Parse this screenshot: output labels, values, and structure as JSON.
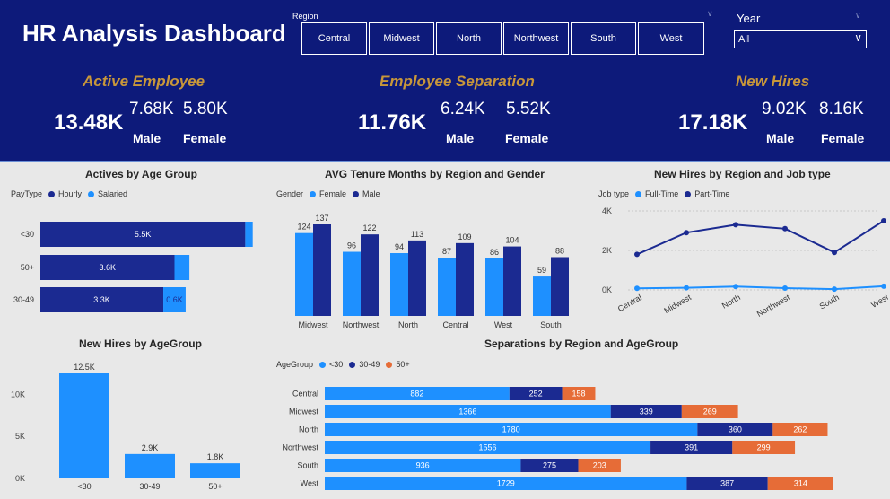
{
  "header": {
    "title": "HR Analysis Dashboard",
    "region_label": "Region",
    "regions": [
      "Central",
      "Midwest",
      "North",
      "Northwest",
      "South",
      "West"
    ],
    "year_label": "Year",
    "year_value": "All"
  },
  "kpis": {
    "active": {
      "title": "Active Employee",
      "total": "13.48K",
      "male": "7.68K",
      "female": "5.80K",
      "male_label": "Male",
      "female_label": "Female"
    },
    "separation": {
      "title": "Employee Separation",
      "total": "11.76K",
      "male": "6.24K",
      "female": "5.52K",
      "male_label": "Male",
      "female_label": "Female"
    },
    "newhires": {
      "title": "New Hires",
      "total": "17.18K",
      "male": "9.02K",
      "female": "8.16K",
      "male_label": "Male",
      "female_label": "Female"
    }
  },
  "colors": {
    "navy": "#1b2a91",
    "blue": "#1e90ff",
    "orange": "#e66c37",
    "header_bg": "#0d1a7a",
    "kpi_gold": "#c8973a"
  },
  "chart_data": [
    {
      "id": "actives-age",
      "type": "bar",
      "orientation": "horizontal",
      "stacked": true,
      "title": "Actives by Age Group",
      "legend_title": "PayType",
      "categories": [
        "<30",
        "50+",
        "30-49"
      ],
      "series": [
        {
          "name": "Hourly",
          "values": [
            5.5,
            3.6,
            3.3
          ],
          "labels": [
            "5.5K",
            "3.6K",
            "3.3K"
          ],
          "color": "#1b2a91"
        },
        {
          "name": "Salaried",
          "values": [
            0.2,
            0.4,
            0.6
          ],
          "labels": [
            "",
            "",
            "0.6K"
          ],
          "color": "#1e90ff"
        }
      ],
      "xlim": [
        0,
        5.9
      ]
    },
    {
      "id": "tenure",
      "type": "bar",
      "orientation": "vertical",
      "title": "AVG Tenure Months by Region and Gender",
      "legend_title": "Gender",
      "categories": [
        "Midwest",
        "Northwest",
        "North",
        "Central",
        "West",
        "South"
      ],
      "series": [
        {
          "name": "Female",
          "values": [
            124,
            96,
            94,
            87,
            86,
            59
          ],
          "color": "#1e90ff"
        },
        {
          "name": "Male",
          "values": [
            137,
            122,
            113,
            109,
            104,
            88
          ],
          "color": "#1b2a91"
        }
      ],
      "ylim": [
        0,
        137
      ]
    },
    {
      "id": "newhires-region",
      "type": "line",
      "title": "New Hires by Region and Job type",
      "legend_title": "Job type",
      "categories": [
        "Central",
        "Midwest",
        "North",
        "Northwest",
        "South",
        "West"
      ],
      "yticks": [
        "0K",
        "2K",
        "4K"
      ],
      "series": [
        {
          "name": "Full-Time",
          "values": [
            80,
            110,
            170,
            90,
            40,
            190
          ],
          "color": "#1e90ff"
        },
        {
          "name": "Part-Time",
          "values": [
            1800,
            2900,
            3300,
            3100,
            1900,
            3500
          ],
          "color": "#1b2a91"
        }
      ],
      "ylim": [
        0,
        4000
      ]
    },
    {
      "id": "newhires-age",
      "type": "bar",
      "orientation": "vertical",
      "title": "New Hires by AgeGroup",
      "categories": [
        "<30",
        "30-49",
        "50+"
      ],
      "values": [
        12.5,
        2.9,
        1.8
      ],
      "labels": [
        "12.5K",
        "2.9K",
        "1.8K"
      ],
      "yticks": [
        "0K",
        "5K",
        "10K"
      ],
      "ylim": [
        0,
        12.5
      ],
      "color": "#1e90ff"
    },
    {
      "id": "separations",
      "type": "bar",
      "orientation": "horizontal",
      "stacked": true,
      "title": "Separations by Region and AgeGroup",
      "legend_title": "AgeGroup",
      "categories": [
        "Central",
        "Midwest",
        "North",
        "Northwest",
        "South",
        "West"
      ],
      "series": [
        {
          "name": "<30",
          "values": [
            882,
            1366,
            1780,
            1556,
            936,
            1729
          ],
          "color": "#1e90ff"
        },
        {
          "name": "30-49",
          "values": [
            252,
            339,
            360,
            391,
            275,
            387
          ],
          "color": "#1b2a91"
        },
        {
          "name": "50+",
          "values": [
            158,
            269,
            262,
            299,
            203,
            314
          ],
          "color": "#e66c37"
        }
      ],
      "xlim": [
        0,
        2430
      ]
    }
  ]
}
